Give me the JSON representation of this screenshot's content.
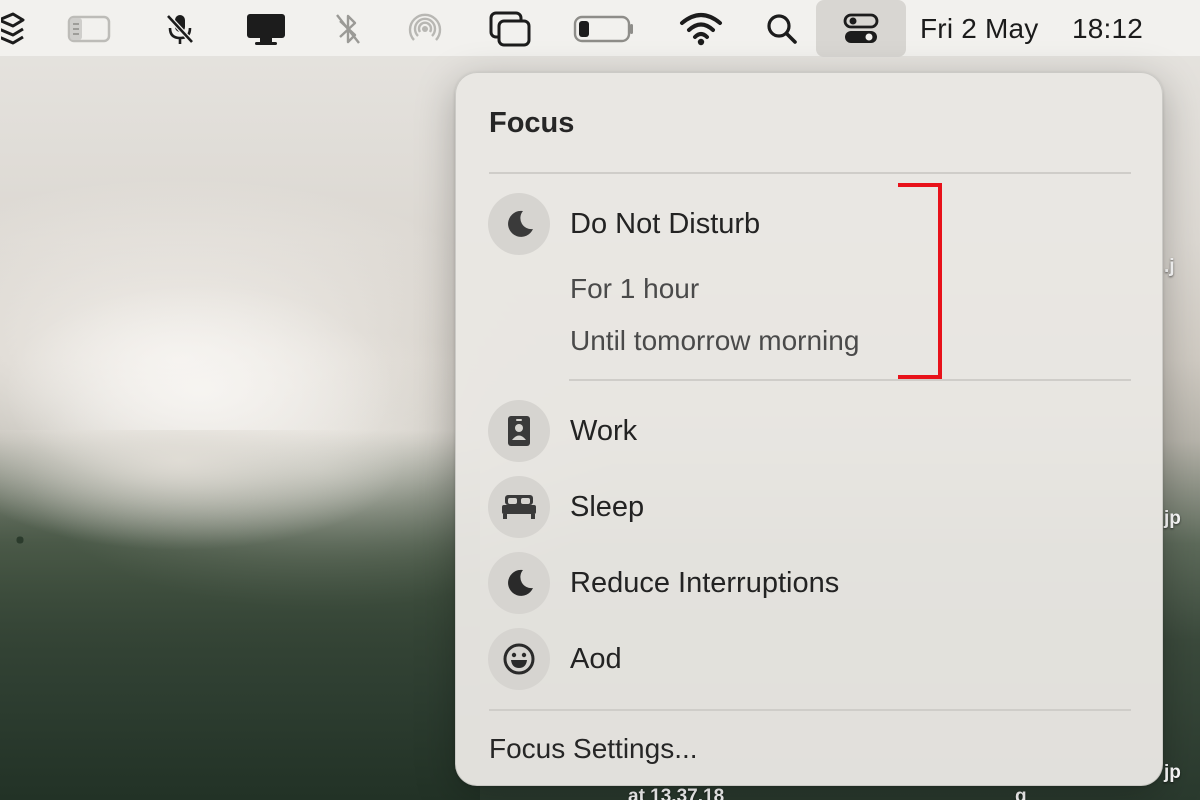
{
  "menubar": {
    "icons": [
      "layers-app-icon",
      "sidebar-toggle-icon",
      "microphone-muted-icon",
      "display-icon",
      "bluetooth-icon",
      "airdrop-icon",
      "screen-mirroring-icon",
      "battery-icon",
      "wifi-icon",
      "search-icon",
      "control-center-icon"
    ],
    "date": "Fri 2 May",
    "time": "18:12"
  },
  "focus_menu": {
    "title": "Focus",
    "do_not_disturb": {
      "label": "Do Not Disturb",
      "icon": "moon-icon",
      "options": [
        "For 1 hour",
        "Until tomorrow morning"
      ]
    },
    "modes": [
      {
        "label": "Work",
        "icon": "id-badge-icon"
      },
      {
        "label": "Sleep",
        "icon": "bed-icon"
      },
      {
        "label": "Reduce Interruptions",
        "icon": "moon-icon"
      },
      {
        "label": "Aod",
        "icon": "smiley-icon"
      }
    ],
    "settings_label": "Focus Settings..."
  },
  "desktop": {
    "file_labels": [
      ".j",
      "jp",
      "jp",
      "at 13.37.18",
      "g"
    ]
  },
  "annotation": {
    "color": "#e8121a"
  }
}
